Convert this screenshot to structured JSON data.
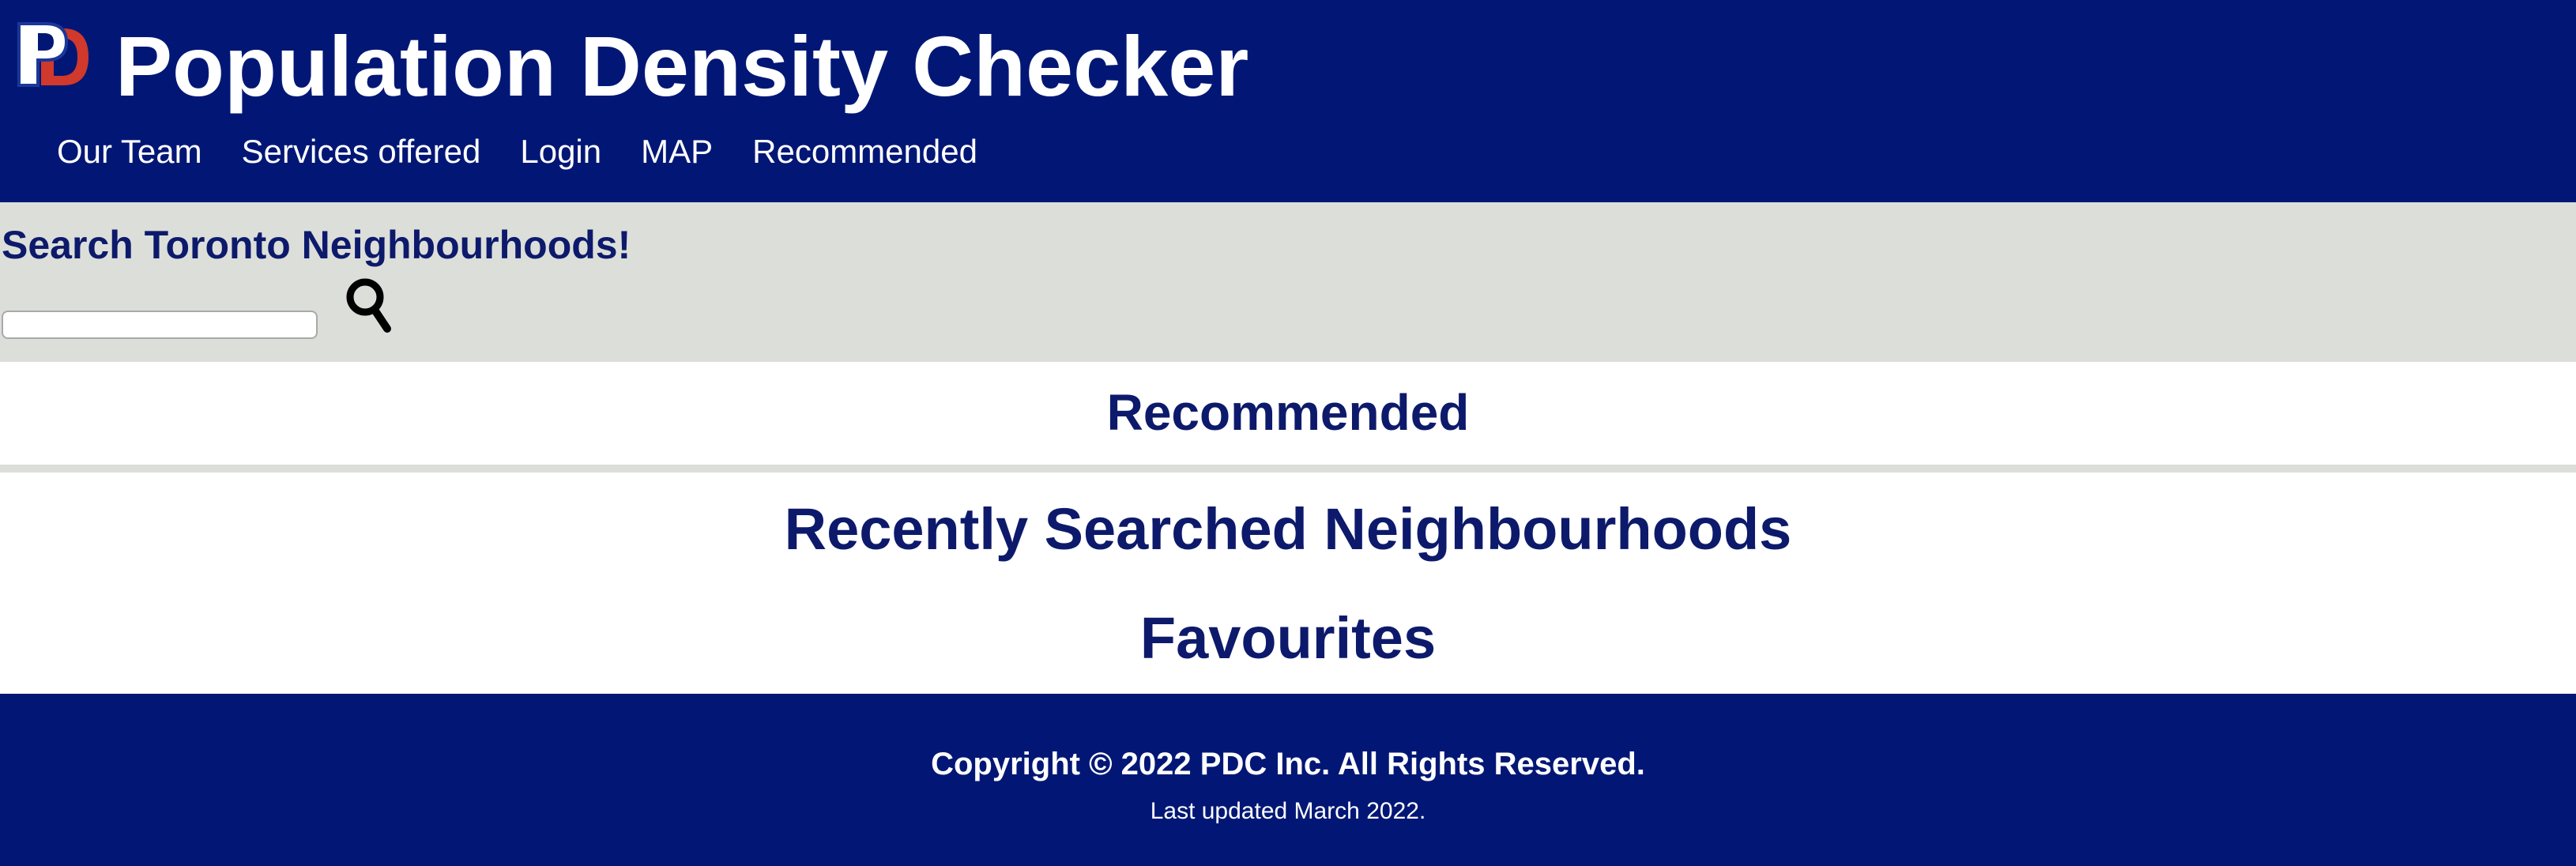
{
  "header": {
    "logo_icon": "pd-monogram-logo",
    "title": "Population Density Checker",
    "nav": [
      {
        "label": "Our Team"
      },
      {
        "label": "Services offered"
      },
      {
        "label": "Login"
      },
      {
        "label": "MAP"
      },
      {
        "label": "Recommended"
      }
    ]
  },
  "search": {
    "heading": "Search Toronto Neighbourhoods!",
    "input_value": "",
    "input_placeholder": "",
    "button_icon": "search-icon"
  },
  "recommended": {
    "heading": "Recommended"
  },
  "lists": {
    "recent_heading": "Recently Searched Neighbourhoods",
    "favourites_heading": "Favourites"
  },
  "footer": {
    "copyright": "Copyright © 2022 PDC Inc. All Rights Reserved.",
    "last_updated": "Last updated March 2022."
  },
  "colors": {
    "header_bg": "#021775",
    "page_bg": "#dcdfd9",
    "heading_text": "#0d1a6b",
    "logo_red": "#d0392b",
    "logo_blue": "#1a3799"
  }
}
